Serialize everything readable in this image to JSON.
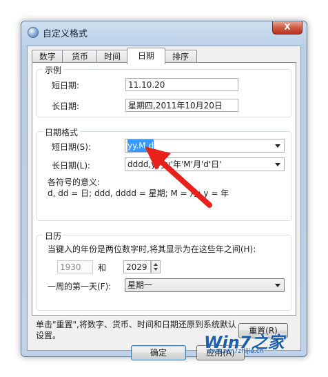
{
  "window": {
    "title": "自定义格式",
    "close_glyph": "X"
  },
  "tabs": [
    {
      "label": "数字"
    },
    {
      "label": "货币"
    },
    {
      "label": "时间"
    },
    {
      "label": "日期",
      "active": true
    },
    {
      "label": "排序"
    }
  ],
  "examples": {
    "legend": "示例",
    "short_label": "短日期:",
    "short_value": "11.10.20",
    "long_label": "长日期:",
    "long_value": "星期四,2011年10月20日"
  },
  "date_formats": {
    "legend": "日期格式",
    "short_label": "短日期(S):",
    "short_value": "yy.M.d",
    "long_label": "长日期(L):",
    "long_value": "dddd,yyyy'年'M'月'd'日'",
    "symbols_title": "各符号的意义:",
    "symbols_text": "d, dd = 日;  ddd, dddd = 星期;  M  = 月;  y = 年"
  },
  "calendar": {
    "legend": "日历",
    "two_digit_label": "当键入的年份是两位数字时,将其显示为在这些年之间(H):",
    "year_from": "1930",
    "and_label": "和",
    "year_to": "2029",
    "first_day_label": "一周的第一天(F):",
    "first_day_value": "星期一"
  },
  "footer": {
    "note": "单击\"重置\",将数字、货币、时间和日期还原到系统默认设置。",
    "reset_label": "重置(R)",
    "ok_label": "确定",
    "apply_label": "应用(A)"
  },
  "watermark": {
    "logo": "Win7之家",
    "url": "www.win7zhijia.cn"
  },
  "colors": {
    "annotation_arrow": "#e8211a",
    "selection": "#3399ff"
  }
}
